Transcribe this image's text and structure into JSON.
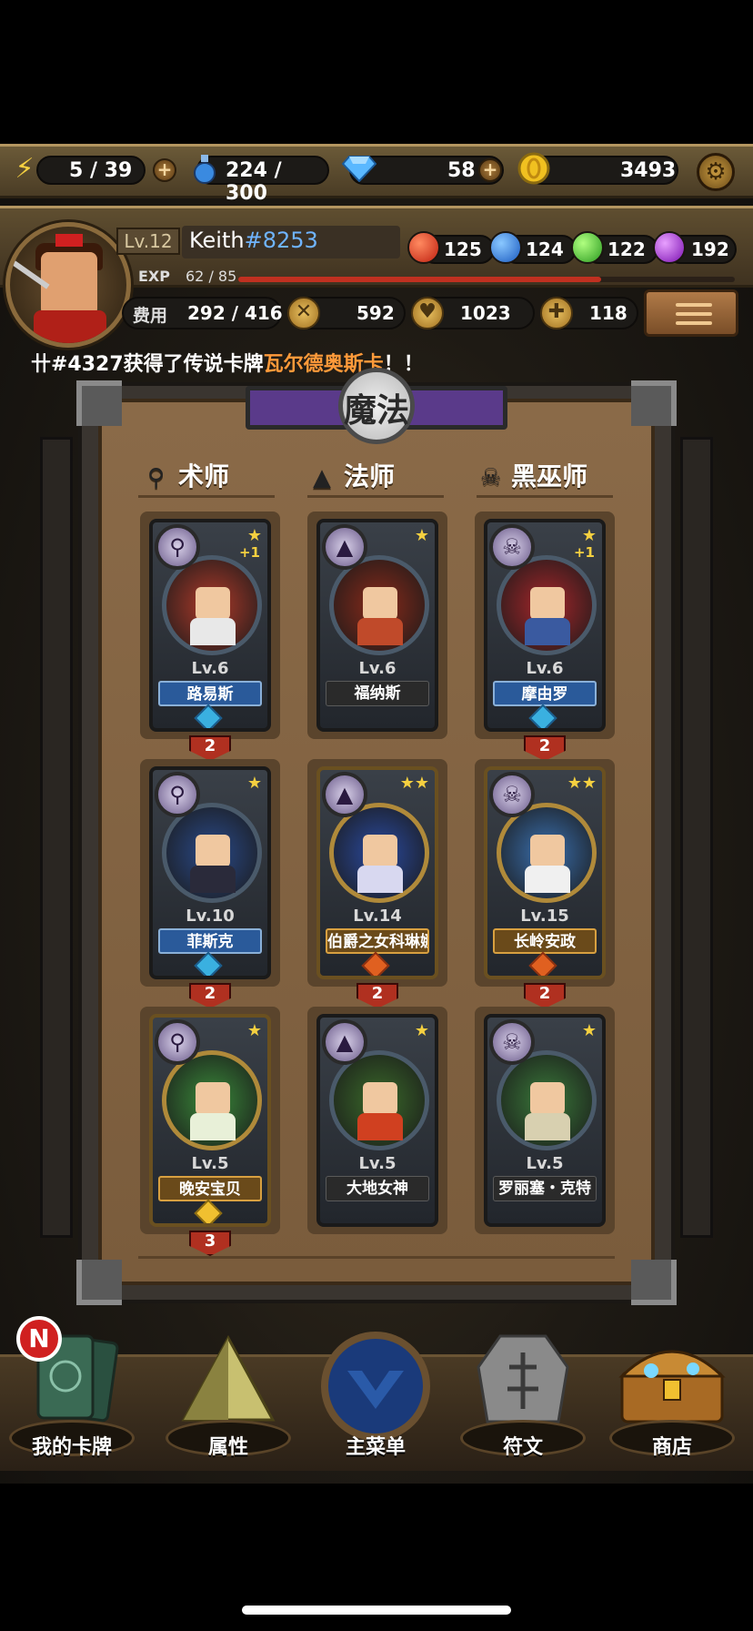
{
  "resources": {
    "energy": "5 / 39",
    "potion": "224 / 300",
    "gems": "58",
    "coins": "3493"
  },
  "player": {
    "level": "Lv.12",
    "name": "Keith",
    "tag": "#8253",
    "exp_label": "EXP",
    "exp_value": "62 / 85",
    "exp_progress": 0.73
  },
  "orbs": [
    {
      "color": "#e03020",
      "value": "125"
    },
    {
      "color": "#2a80e0",
      "value": "124"
    },
    {
      "color": "#40c030",
      "value": "122"
    },
    {
      "color": "#a030d0",
      "value": "192"
    }
  ],
  "stats": {
    "cost_label": "费用",
    "cost_value": "292 / 416",
    "attack": "592",
    "hp": "1023",
    "heal": "118"
  },
  "announcement": {
    "prefix": "卄#4327获得了传说卡牌",
    "highlight": "瓦尔德奥斯卡",
    "suffix": "！！"
  },
  "panel": {
    "title": "魔法",
    "columns": [
      {
        "label": "术师",
        "icon": "staff-icon"
      },
      {
        "label": "法师",
        "icon": "wizard-hat-icon"
      },
      {
        "label": "黑巫师",
        "icon": "skull-icon"
      }
    ]
  },
  "cards": [
    {
      "level": "Lv.6",
      "name": "路易斯",
      "stars": "★",
      "plus": "+1",
      "count": "2",
      "class_icon": "staff-icon"
    },
    {
      "level": "Lv.6",
      "name": "福纳斯",
      "stars": "★",
      "plus": "",
      "count": "",
      "class_icon": "wizard-hat-icon"
    },
    {
      "level": "Lv.6",
      "name": "摩由罗",
      "stars": "★",
      "plus": "+1",
      "count": "2",
      "class_icon": "skull-icon"
    },
    {
      "level": "Lv.10",
      "name": "菲斯克",
      "stars": "★",
      "plus": "",
      "count": "2",
      "class_icon": "staff-icon"
    },
    {
      "level": "Lv.14",
      "name": "伯爵之女科琳娜",
      "stars": "★★",
      "plus": "",
      "count": "2",
      "class_icon": "wizard-hat-icon"
    },
    {
      "level": "Lv.15",
      "name": "长岭安政",
      "stars": "★★",
      "plus": "",
      "count": "2",
      "class_icon": "skull-icon"
    },
    {
      "level": "Lv.5",
      "name": "晚安宝贝",
      "stars": "★",
      "plus": "",
      "count": "3",
      "class_icon": "staff-icon"
    },
    {
      "level": "Lv.5",
      "name": "大地女神",
      "stars": "★",
      "plus": "",
      "count": "",
      "class_icon": "wizard-hat-icon"
    },
    {
      "level": "Lv.5",
      "name": "罗丽塞・克特",
      "stars": "★",
      "plus": "",
      "count": "",
      "class_icon": "skull-icon"
    }
  ],
  "nav": {
    "badge": "N",
    "items": [
      "我的卡牌",
      "属性",
      "主菜单",
      "符文",
      "商店"
    ]
  }
}
